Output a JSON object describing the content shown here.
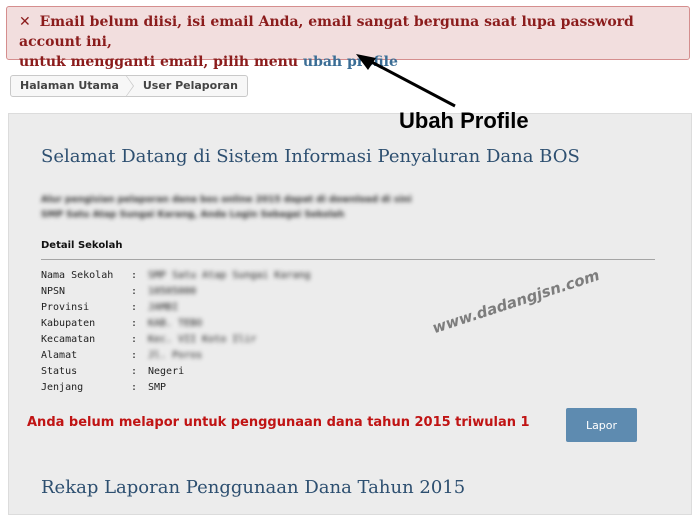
{
  "alert": {
    "icon": "close-icon",
    "line1": "Email belum diisi, isi email Anda, email sangat berguna saat lupa password account ini,",
    "line2": "untuk mengganti email, pilih menu ",
    "link": "ubah profile"
  },
  "breadcrumb": {
    "home": "Halaman Utama",
    "current": "User Pelaporan"
  },
  "annotation": "Ubah Profile",
  "page": {
    "title": "Selamat Datang di Sistem Informasi Penyaluran Dana BOS",
    "blur_line1": "Alur pengisian pelaporan dana bos online 2015 dapat di download di sini",
    "blur_line2": "SMP Satu Atap Sungai Karang, Anda Login Sebagai Sekolah",
    "detail_title": "Detail Sekolah",
    "rows": [
      {
        "label": "Nama Sekolah",
        "sep": ":",
        "value": "SMP Satu Atap Sungai Karang"
      },
      {
        "label": "NPSN",
        "sep": ":",
        "value": "10505000"
      },
      {
        "label": "Provinsi",
        "sep": ":",
        "value": "JAMBI"
      },
      {
        "label": "Kabupaten",
        "sep": ":",
        "value": "KAB. TEBO"
      },
      {
        "label": "Kecamatan",
        "sep": ":",
        "value": "Kec. VII Koto Ilir"
      },
      {
        "label": "Alamat",
        "sep": ":",
        "value": "Jl. Poros"
      },
      {
        "label": "Status",
        "sep": ":",
        "value": "Negeri"
      },
      {
        "label": "Jenjang",
        "sep": ":",
        "value": "SMP"
      }
    ],
    "warning": "Anda belum melapor untuk penggunaan dana tahun 2015 triwulan 1",
    "lapor_button": "Lapor",
    "subtitle": "Rekap Laporan Penggunaan Dana Tahun 2015",
    "watermark": "www.dadangjsn.com"
  }
}
